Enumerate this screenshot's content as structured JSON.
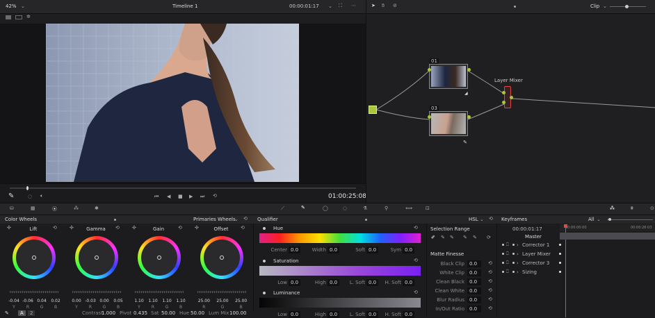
{
  "viewer": {
    "zoom": "42%",
    "timeline_name": "Timeline 1",
    "source_timecode": "00:00:01:17",
    "record_timecode": "01:00:25:08"
  },
  "nodes": {
    "mode": "Clip",
    "node1_label": "01",
    "node2_label": "03",
    "layer_mixer_label": "Layer Mixer"
  },
  "color_wheels": {
    "title": "Color Wheels",
    "mode": "Primaries Wheels",
    "wheels": [
      {
        "name": "Lift",
        "values": [
          "-0.04",
          "-0.06",
          "0.04",
          "0.02"
        ],
        "channels": [
          "Y",
          "R",
          "G",
          "B"
        ]
      },
      {
        "name": "Gamma",
        "values": [
          "0.00",
          "-0.03",
          "0.00",
          "0.05"
        ],
        "channels": [
          "Y",
          "R",
          "G",
          "B"
        ]
      },
      {
        "name": "Gain",
        "values": [
          "1.10",
          "1.10",
          "1.10",
          "1.10"
        ],
        "channels": [
          "Y",
          "R",
          "G",
          "B"
        ]
      },
      {
        "name": "Offset",
        "values": [
          "25.00",
          "25.00",
          "25.00"
        ],
        "channels": [
          "R",
          "G",
          "B"
        ]
      }
    ],
    "footer": {
      "page": "2",
      "contrast_label": "Contrast",
      "contrast": "1.000",
      "pivot_label": "Pivot",
      "pivot": "0.435",
      "sat_label": "Sat",
      "sat": "50.00",
      "hue_label": "Hue",
      "hue": "50.00",
      "lummix_label": "Lum Mix",
      "lummix": "100.00"
    }
  },
  "qualifier": {
    "title": "Qualifier",
    "mode": "HSL",
    "hue": {
      "label": "Hue",
      "params": [
        [
          "Center",
          "0.0"
        ],
        [
          "Width",
          "0.0"
        ],
        [
          "Soft",
          "0.0"
        ],
        [
          "Sym",
          "0.0"
        ]
      ]
    },
    "saturation": {
      "label": "Saturation",
      "params": [
        [
          "Low",
          "0.0"
        ],
        [
          "High",
          "0.0"
        ],
        [
          "L. Soft",
          "0.0"
        ],
        [
          "H. Soft",
          "0.0"
        ]
      ]
    },
    "luminance": {
      "label": "Luminance",
      "params": [
        [
          "Low",
          "0.0"
        ],
        [
          "High",
          "0.0"
        ],
        [
          "L. Soft",
          "0.0"
        ],
        [
          "H. Soft",
          "0.0"
        ]
      ]
    },
    "selection_range": "Selection Range",
    "matte_finesse": "Matte Finesse",
    "matte": [
      [
        "Black Clip",
        "0.0"
      ],
      [
        "White Clip",
        "0.0"
      ],
      [
        "Clean Black",
        "0.0"
      ],
      [
        "Clean White",
        "0.0"
      ],
      [
        "Blur Radius",
        "0.0"
      ],
      [
        "In/Out Ratio",
        "0.0"
      ]
    ]
  },
  "keyframes": {
    "title": "Keyframes",
    "filter": "All",
    "timecode": "00:00:01:17",
    "ruler_start": "00:00:00:00",
    "ruler_end": "00:00:26:03",
    "master": "Master",
    "tracks": [
      "Corrector 1",
      "Layer Mixer",
      "Corrector 3",
      "Sizing"
    ]
  },
  "colors": {
    "accent": "#e04848",
    "node_green": "#a8c83a",
    "panel": "#232326",
    "bg": "#1b1b1d"
  }
}
